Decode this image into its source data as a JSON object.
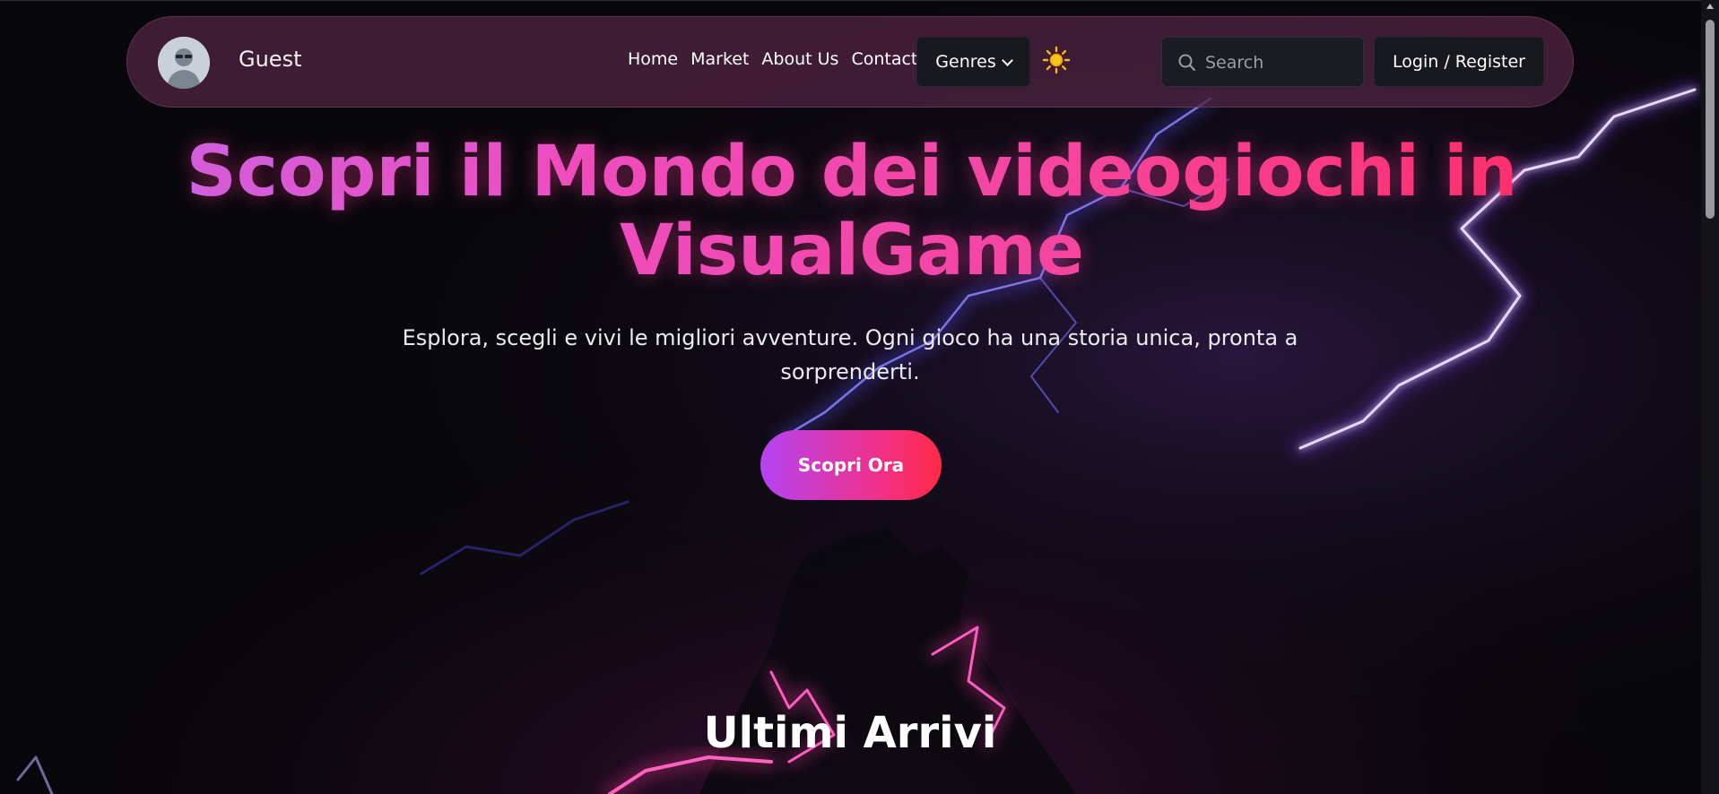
{
  "navbar": {
    "username": "Guest",
    "links": [
      "Home",
      "Market",
      "About Us",
      "Contact"
    ],
    "genres_label": "Genres",
    "theme_icon": "sun-icon",
    "search_placeholder": "Search",
    "login_label": "Login / Register"
  },
  "hero": {
    "title": "Scopri il Mondo dei videogiochi in VisualGame",
    "subtitle": "Esplora, scegli e vivi le migliori avventure. Ogni gioco ha una storia unica, pronta a sorprenderti.",
    "cta_label": "Scopri Ora"
  },
  "section": {
    "latest_title": "Ultimi Arrivi"
  },
  "colors": {
    "accent_purple": "#b444f2",
    "accent_pink": "#f0308a",
    "accent_red": "#ff2a47",
    "navbar_bg": "#4e2240",
    "sun_yellow": "#f5c518",
    "lightning": "#6a5cff"
  }
}
